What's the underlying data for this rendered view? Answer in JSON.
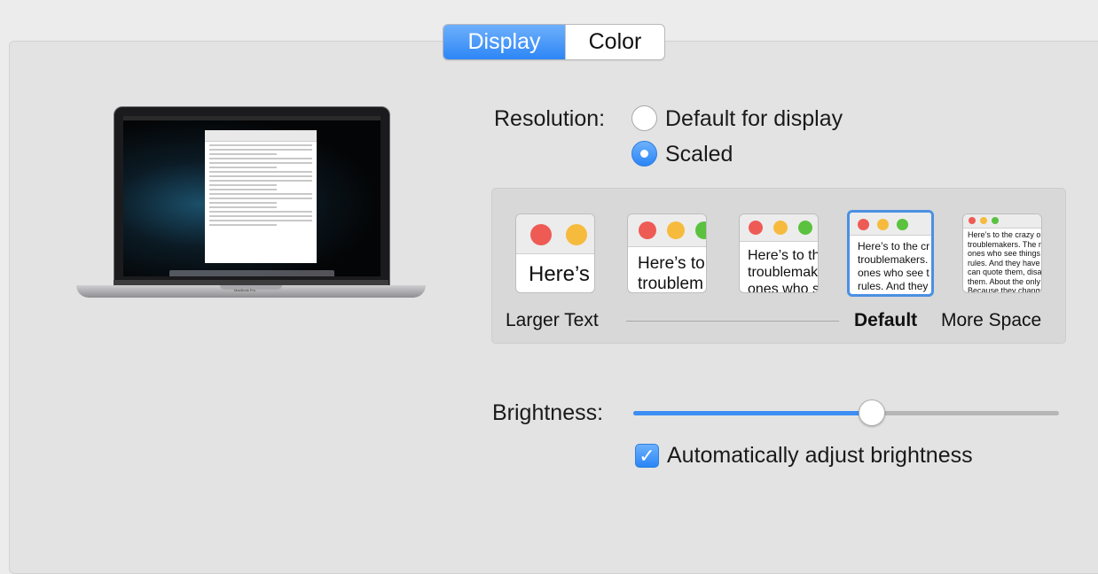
{
  "tabs": [
    {
      "label": "Display",
      "active": true
    },
    {
      "label": "Color",
      "active": false
    }
  ],
  "laptop": {
    "brand_text": "MacBook Pro"
  },
  "resolution": {
    "label": "Resolution:",
    "options": [
      {
        "label": "Default for display",
        "selected": false
      },
      {
        "label": "Scaled",
        "selected": true
      }
    ]
  },
  "scaling": {
    "previews": [
      {
        "text": "Here’s"
      },
      {
        "text": "Here’s to\ntroublem"
      },
      {
        "text": "Here’s to th\ntroublemak\nones who s"
      },
      {
        "text": "Here’s to the cr\ntroublemakers.\nones who see t\nrules. And they"
      },
      {
        "text": "Here’s to the crazy one\ntroublemakers. The rou\nones who see things dif\nrules. And they have no\ncan quote them, disagre\nthem. About the only th\nBecause they change t"
      }
    ],
    "selected_index": 3,
    "labels": {
      "larger": "Larger Text",
      "default": "Default",
      "more": "More Space"
    }
  },
  "brightness": {
    "label": "Brightness:",
    "level_percent": 56,
    "auto_label": "Automatically adjust brightness",
    "auto_checked": true
  },
  "colors": {
    "accent": "#3c8ef3"
  }
}
